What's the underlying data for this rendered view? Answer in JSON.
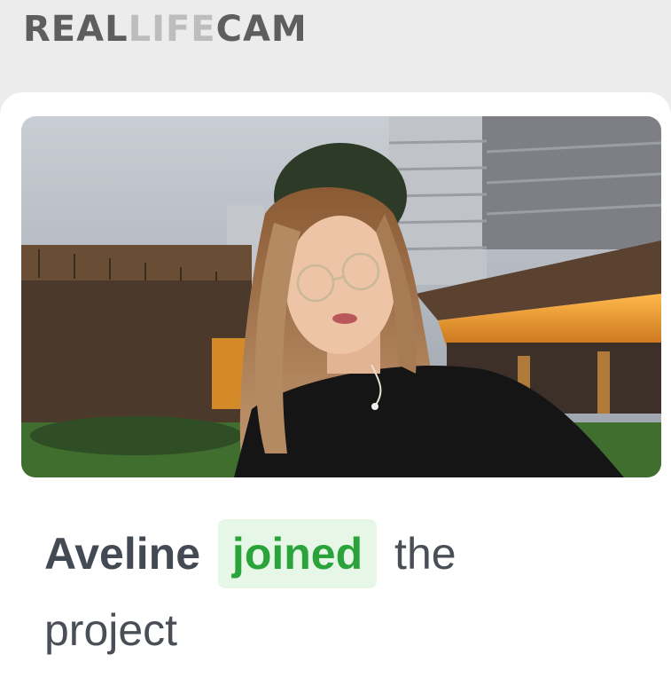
{
  "header": {
    "logo_part1": "REAL",
    "logo_part2": "LIFE",
    "logo_part3": "CAM"
  },
  "card": {
    "photo_icon": "profile-photo",
    "name": "Aveline",
    "status": "joined",
    "suffix_word1": "the",
    "suffix_word2": "project"
  },
  "colors": {
    "status_green": "#2aa33b",
    "status_bg": "#e6f6e7",
    "text_dark": "#434a54"
  }
}
